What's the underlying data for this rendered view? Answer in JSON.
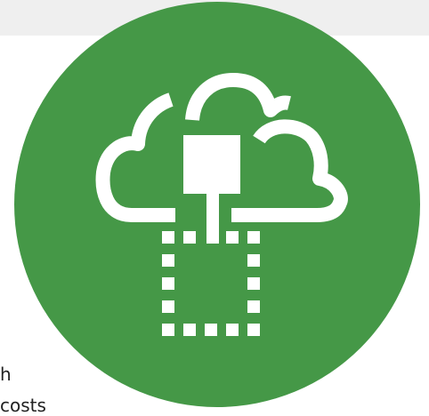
{
  "page_text": {
    "line_1": "h",
    "line_2": "costs"
  },
  "hero_icon": {
    "name": "cloud-migration-icon",
    "background_color": "#459847",
    "foreground_color": "#ffffff",
    "top_bar_color": "#efefef"
  }
}
